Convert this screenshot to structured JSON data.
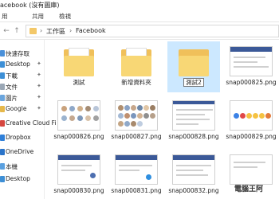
{
  "window": {
    "title": "acebook (沒有圖庫)"
  },
  "ribbon": {
    "tabs": [
      "用",
      "共用",
      "檢視"
    ]
  },
  "address": {
    "crumbs": [
      "工作區",
      "Facebook"
    ],
    "separator": "›"
  },
  "sidebar": {
    "items": [
      {
        "label": "快速存取",
        "pinned": false
      },
      {
        "label": "Desktop",
        "pinned": true
      },
      {
        "label": "下載",
        "pinned": true
      },
      {
        "label": "文件",
        "pinned": true
      },
      {
        "label": "圖片",
        "pinned": true
      },
      {
        "label": "Google",
        "pinned": true
      },
      {
        "label": "Creative Cloud Fi",
        "pinned": false
      },
      {
        "label": "Dropbox",
        "pinned": false
      },
      {
        "label": "OneDrive",
        "pinned": false
      },
      {
        "label": "本機",
        "pinned": false
      },
      {
        "label": "Desktop",
        "pinned": false
      }
    ],
    "pin_glyph": "✦"
  },
  "files": [
    {
      "label": "測試",
      "kind": "folder"
    },
    {
      "label": "新增資料夾",
      "kind": "folder"
    },
    {
      "label": "測試2",
      "kind": "folder",
      "selected": true
    },
    {
      "label": "snap000825.png",
      "kind": "image"
    },
    {
      "label": "snap000826.png",
      "kind": "image"
    },
    {
      "label": "snap000827.png",
      "kind": "image"
    },
    {
      "label": "snap000828.png",
      "kind": "image"
    },
    {
      "label": "snap000829.png",
      "kind": "image"
    },
    {
      "label": "snap000830.png",
      "kind": "image"
    },
    {
      "label": "snap000831.png",
      "kind": "image"
    },
    {
      "label": "snap000832.png",
      "kind": "image"
    },
    {
      "label": "",
      "kind": "image"
    }
  ],
  "watermark": "電腦王阿",
  "colors": {
    "folder": "#f8d775",
    "selection": "#cce8ff",
    "facebook_blue": "#3b5998"
  }
}
